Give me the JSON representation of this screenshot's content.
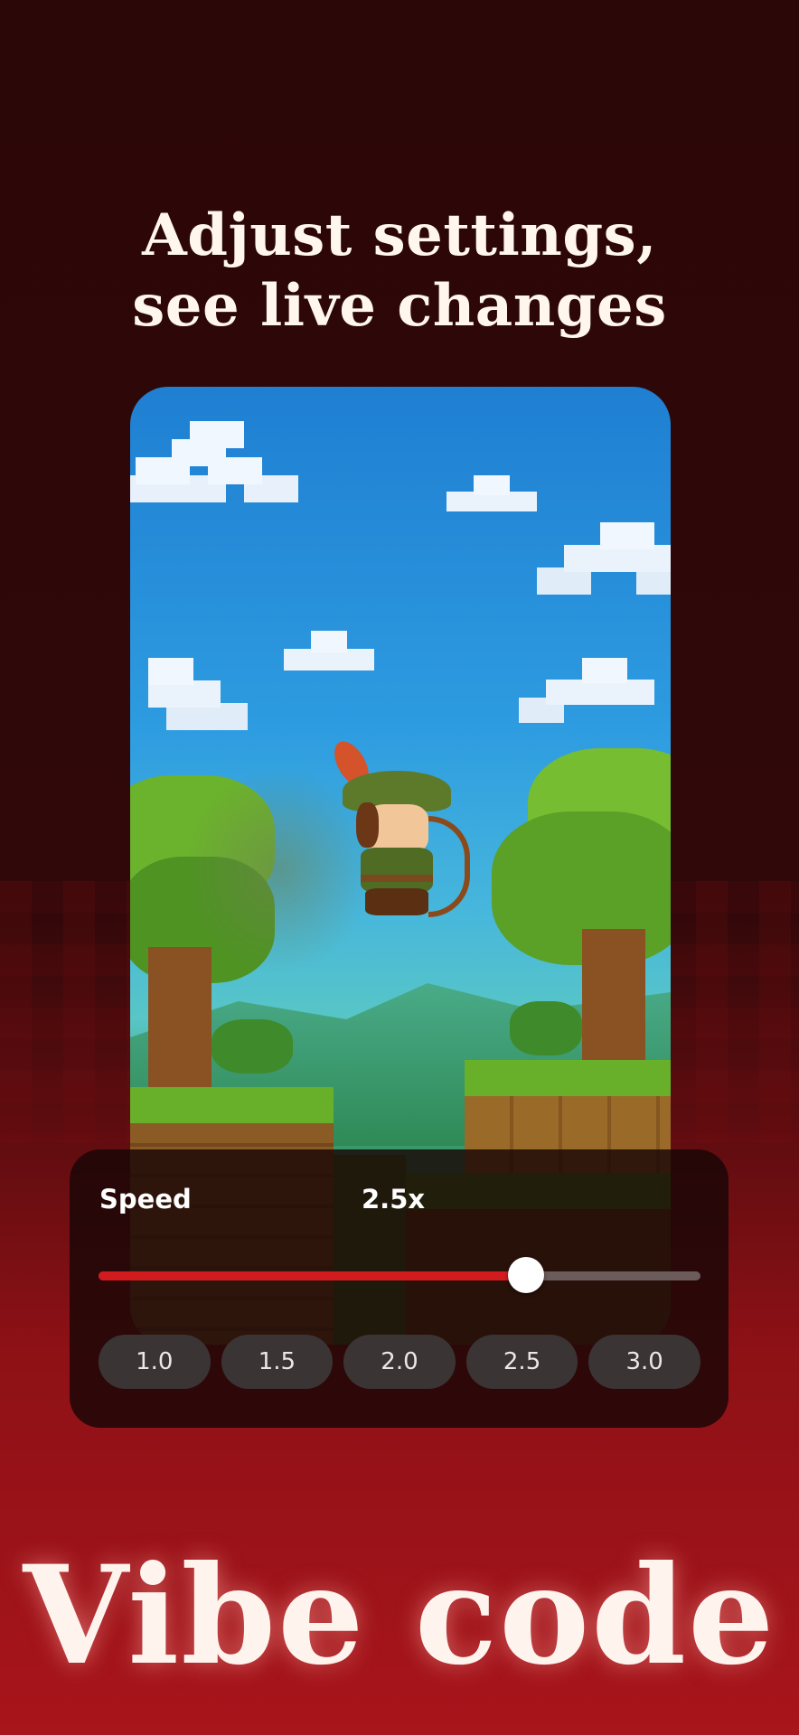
{
  "headline": {
    "line1": "Adjust settings,",
    "line2": "see live changes"
  },
  "preview": {
    "scene": "pixel-art archer running through a forest"
  },
  "controls": {
    "speed_label": "Speed",
    "speed_value": "2.5x",
    "speed_fraction": 0.71,
    "presets": [
      "1.0",
      "1.5",
      "2.0",
      "2.5",
      "3.0"
    ]
  },
  "brand": {
    "name": "Vibe code"
  },
  "colors": {
    "accent": "#d21b1f",
    "background": "#2c0708",
    "panel": "#180606"
  }
}
